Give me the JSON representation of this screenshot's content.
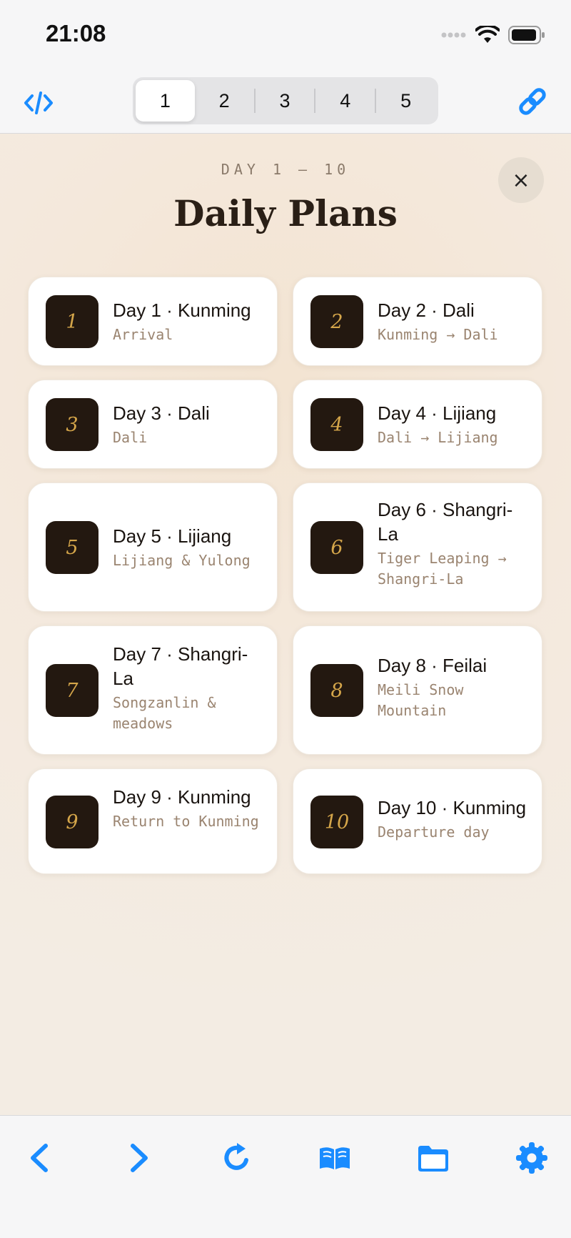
{
  "status": {
    "time": "21:08"
  },
  "tabs": [
    "1",
    "2",
    "3",
    "4",
    "5"
  ],
  "header": {
    "kicker": "DAY 1 — 10",
    "title": "Daily Plans",
    "close": "×"
  },
  "cards": [
    {
      "num": "1",
      "title": "Day 1 · Kunming",
      "sub": "Arrival"
    },
    {
      "num": "2",
      "title": "Day 2 · Dali",
      "sub": "Kunming → Dali"
    },
    {
      "num": "3",
      "title": "Day 3 · Dali",
      "sub": "Dali"
    },
    {
      "num": "4",
      "title": "Day 4 · Lijiang",
      "sub": "Dali → Lijiang"
    },
    {
      "num": "5",
      "title": "Day 5 · Lijiang",
      "sub": "Lijiang & Yulong"
    },
    {
      "num": "6",
      "title": "Day 6 · Shangri-La",
      "sub": "Tiger Leaping → Shangri-La"
    },
    {
      "num": "7",
      "title": "Day 7 · Shangri-La",
      "sub": "Songzanlin & meadows"
    },
    {
      "num": "8",
      "title": "Day 8 · Feilai",
      "sub": "Meili Snow Mountain"
    },
    {
      "num": "9",
      "title": "Day 9 · Kunming",
      "sub": "Return to Kunming"
    },
    {
      "num": "10",
      "title": "Day 10 · Kunming",
      "sub": "Departure day"
    }
  ],
  "colors": {
    "accent": "#1a8cff",
    "badge_bg": "#231810",
    "badge_fg": "#d5a64a"
  },
  "icons": [
    "code-icon",
    "link-icon",
    "back-icon",
    "forward-icon",
    "reload-icon",
    "book-icon",
    "folder-icon",
    "gear-icon"
  ]
}
